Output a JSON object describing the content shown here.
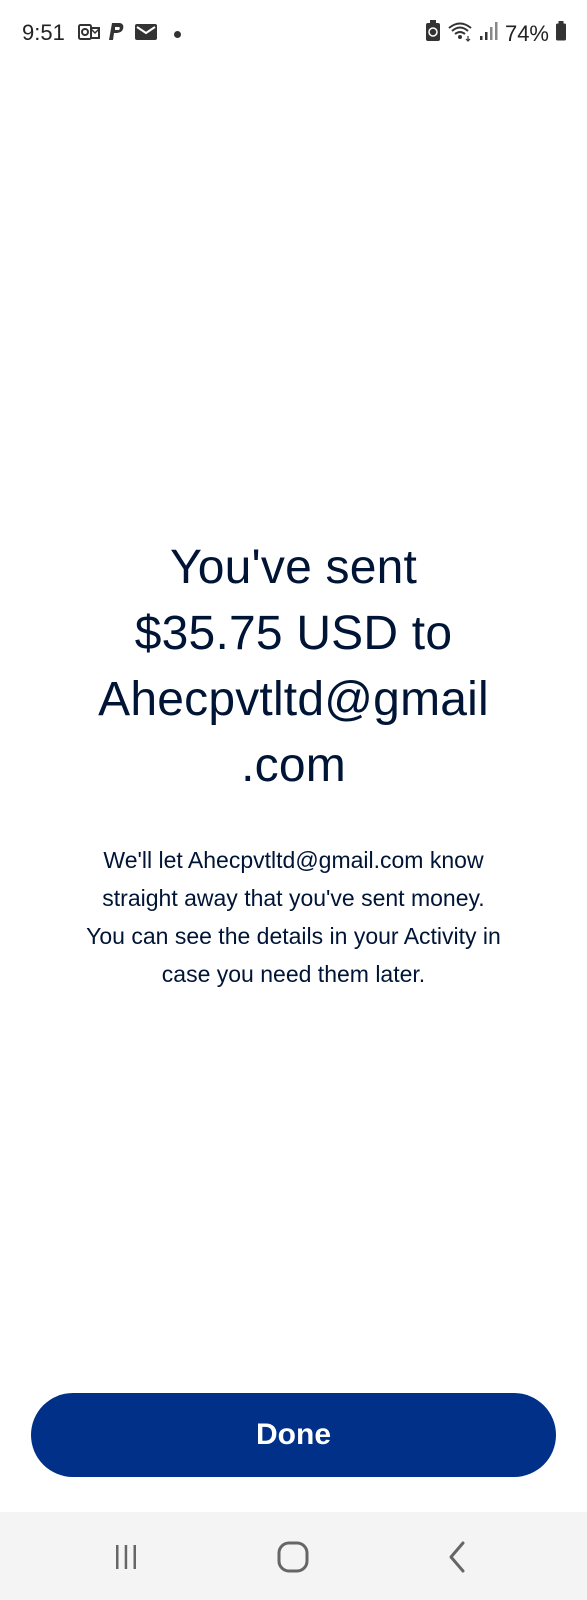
{
  "status_bar": {
    "time": "9:51",
    "battery": "74%",
    "left_icons": [
      "outlook-icon",
      "paypal-icon",
      "mail-icon",
      "notification-dot"
    ],
    "right_icons": [
      "battery-saver-icon",
      "wifi-icon",
      "signal-icon",
      "battery-icon"
    ]
  },
  "confirmation": {
    "headline_lines": [
      "You've sent",
      "$35.75 USD to",
      "Ahecpvtltd@gmail",
      ".com"
    ],
    "body_lines": [
      "We'll let Ahecpvtltd@gmail.com know",
      "straight away that you've sent money.",
      "You can see the details in your Activity in",
      "case you need them later."
    ]
  },
  "actions": {
    "done_label": "Done"
  },
  "nav_bar": {
    "items": [
      "recent-apps-icon",
      "home-icon",
      "back-icon"
    ]
  },
  "colors": {
    "text_primary": "#001435",
    "button_bg": "#003087",
    "button_text": "#ffffff",
    "nav_bg": "#f4f4f4"
  }
}
